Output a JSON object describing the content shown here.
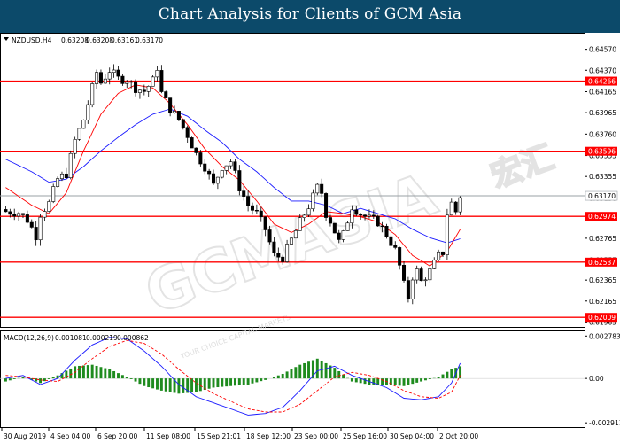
{
  "banner": {
    "title": "Chart Analysis for Clients of GCM Asia"
  },
  "watermark": {
    "brand": "GCMASIA",
    "chinese": "宏汇",
    "tagline": "YOUR CHOICE CAPITAL MARKETS"
  },
  "colors": {
    "banner": "#0c4a6a",
    "candle_up_fill": "#ffffff",
    "candle_outline": "#000000",
    "ma_fast": "#ff0000",
    "ma_slow": "#1a1aff",
    "level": "#ff0000",
    "level_label_bg": "#ff0000",
    "current_price": "#9aa0a6",
    "macd_hist": "#1e8b1e",
    "macd_line": "#1a1aff",
    "macd_signal": "#ff0000"
  },
  "chart_data": [
    {
      "type": "candlestick",
      "panel": "main",
      "header": {
        "symbol_timeframe": "NZDUSD,H4",
        "open": "0.63208",
        "high": "0.63208",
        "low": "0.63161",
        "close": "0.63170"
      },
      "y_axis_ticks": [
        "0.64570",
        "0.64370",
        "0.64165",
        "0.63965",
        "0.63760",
        "0.63555",
        "0.63355",
        "0.63150",
        "0.62950",
        "0.62765",
        "0.62555",
        "0.62365",
        "0.62165",
        "0.61965"
      ],
      "ylim": [
        0.6196,
        0.6466
      ],
      "x_axis_ticks": [
        "30 Aug 2019",
        "4 Sep 04:00",
        "6 Sep 20:00",
        "11 Sep 08:00",
        "15 Sep 21:01",
        "18 Sep 12:00",
        "23 Sep 00:00",
        "25 Sep 16:00",
        "30 Sep 04:00",
        "2 Oct 20:00"
      ],
      "levels": [
        {
          "label": "0.64266",
          "value": 0.64266
        },
        {
          "label": "0.63596",
          "value": 0.63596
        },
        {
          "label": "0.62974",
          "value": 0.62974
        },
        {
          "label": "0.62537",
          "value": 0.62537
        },
        {
          "label": "0.62009",
          "value": 0.62009
        }
      ],
      "current_price": {
        "label": "0.63170",
        "value": 0.6317
      },
      "close_path": [
        [
          0,
          0.6302
        ],
        [
          3,
          0.6301
        ],
        [
          5,
          0.6294
        ],
        [
          7,
          0.6279
        ],
        [
          8,
          0.63
        ],
        [
          10,
          0.631
        ],
        [
          12,
          0.6333
        ],
        [
          14,
          0.6338
        ],
        [
          16,
          0.637
        ],
        [
          18,
          0.639
        ],
        [
          20,
          0.642
        ],
        [
          21,
          0.6435
        ],
        [
          22,
          0.6425
        ],
        [
          24,
          0.6437
        ],
        [
          26,
          0.6429
        ],
        [
          28,
          0.6428
        ],
        [
          30,
          0.642
        ],
        [
          32,
          0.6417
        ],
        [
          34,
          0.6427
        ],
        [
          35,
          0.644
        ],
        [
          36,
          0.6415
        ],
        [
          38,
          0.64
        ],
        [
          40,
          0.639
        ],
        [
          42,
          0.6375
        ],
        [
          44,
          0.6357
        ],
        [
          46,
          0.6345
        ],
        [
          48,
          0.6327
        ],
        [
          50,
          0.6345
        ],
        [
          52,
          0.635
        ],
        [
          54,
          0.6325
        ],
        [
          56,
          0.6308
        ],
        [
          58,
          0.63
        ],
        [
          60,
          0.6285
        ],
        [
          62,
          0.626
        ],
        [
          64,
          0.6258
        ],
        [
          66,
          0.6275
        ],
        [
          68,
          0.6292
        ],
        [
          70,
          0.6307
        ],
        [
          72,
          0.6325
        ],
        [
          73,
          0.632
        ],
        [
          74,
          0.63
        ],
        [
          75,
          0.6293
        ],
        [
          77,
          0.6273
        ],
        [
          78,
          0.628
        ],
        [
          80,
          0.6307
        ],
        [
          82,
          0.63
        ],
        [
          84,
          0.6295
        ],
        [
          86,
          0.6292
        ],
        [
          88,
          0.628
        ],
        [
          90,
          0.6265
        ],
        [
          91,
          0.625
        ],
        [
          92,
          0.6232
        ],
        [
          93,
          0.622
        ],
        [
          94,
          0.624
        ],
        [
          95,
          0.6245
        ],
        [
          96,
          0.6235
        ],
        [
          98,
          0.6245
        ],
        [
          100,
          0.626
        ],
        [
          101,
          0.6263
        ],
        [
          102,
          0.63
        ],
        [
          103,
          0.631
        ],
        [
          104,
          0.6302
        ],
        [
          105,
          0.6317
        ]
      ],
      "ma_fast_path": [
        [
          0,
          0.6325
        ],
        [
          6,
          0.6308
        ],
        [
          10,
          0.63
        ],
        [
          14,
          0.632
        ],
        [
          18,
          0.636
        ],
        [
          22,
          0.6395
        ],
        [
          26,
          0.6415
        ],
        [
          30,
          0.6423
        ],
        [
          34,
          0.642
        ],
        [
          38,
          0.6405
        ],
        [
          42,
          0.6385
        ],
        [
          46,
          0.6362
        ],
        [
          50,
          0.6345
        ],
        [
          54,
          0.6332
        ],
        [
          58,
          0.6312
        ],
        [
          62,
          0.629
        ],
        [
          66,
          0.6282
        ],
        [
          70,
          0.629
        ],
        [
          74,
          0.6302
        ],
        [
          78,
          0.63
        ],
        [
          82,
          0.6297
        ],
        [
          86,
          0.6292
        ],
        [
          90,
          0.628
        ],
        [
          94,
          0.626
        ],
        [
          98,
          0.625
        ],
        [
          102,
          0.6264
        ],
        [
          105,
          0.6285
        ]
      ],
      "ma_slow_path": [
        [
          0,
          0.6352
        ],
        [
          6,
          0.634
        ],
        [
          10,
          0.633
        ],
        [
          14,
          0.6333
        ],
        [
          18,
          0.6345
        ],
        [
          22,
          0.636
        ],
        [
          26,
          0.6373
        ],
        [
          30,
          0.6385
        ],
        [
          34,
          0.6395
        ],
        [
          38,
          0.64
        ],
        [
          42,
          0.6393
        ],
        [
          46,
          0.638
        ],
        [
          50,
          0.6368
        ],
        [
          54,
          0.6352
        ],
        [
          58,
          0.634
        ],
        [
          62,
          0.6325
        ],
        [
          66,
          0.6312
        ],
        [
          70,
          0.6312
        ],
        [
          74,
          0.6308
        ],
        [
          78,
          0.63
        ],
        [
          82,
          0.6305
        ],
        [
          86,
          0.63
        ],
        [
          90,
          0.6295
        ],
        [
          94,
          0.6285
        ],
        [
          98,
          0.6277
        ],
        [
          102,
          0.6272
        ],
        [
          105,
          0.6276
        ]
      ]
    },
    {
      "type": "macd",
      "panel": "indicator",
      "header": {
        "label": "MACD(12,26,9)",
        "main": "0.001081",
        "signal": "0.000219",
        "histogram": "0.000862"
      },
      "y_axis_ticks": [
        "0.002783",
        "0.00",
        "-0.002911"
      ],
      "ylim": [
        -0.0029,
        0.0028
      ],
      "macd_path": [
        [
          0,
          0.0
        ],
        [
          4,
          0.0002
        ],
        [
          8,
          -0.0004
        ],
        [
          12,
          0.0
        ],
        [
          16,
          0.0012
        ],
        [
          20,
          0.0022
        ],
        [
          24,
          0.0027
        ],
        [
          28,
          0.0026
        ],
        [
          32,
          0.0018
        ],
        [
          36,
          0.0008
        ],
        [
          40,
          -0.0004
        ],
        [
          44,
          -0.0012
        ],
        [
          48,
          -0.0016
        ],
        [
          52,
          -0.002
        ],
        [
          56,
          -0.0024
        ],
        [
          60,
          -0.0023
        ],
        [
          64,
          -0.0019
        ],
        [
          68,
          -0.0008
        ],
        [
          72,
          0.0005
        ],
        [
          76,
          0.0008
        ],
        [
          80,
          0.0002
        ],
        [
          84,
          -0.0002
        ],
        [
          88,
          -0.0006
        ],
        [
          92,
          -0.0013
        ],
        [
          96,
          -0.0014
        ],
        [
          100,
          -0.0012
        ],
        [
          103,
          -0.0003
        ],
        [
          105,
          0.001
        ]
      ],
      "signal_path": [
        [
          0,
          0.0002
        ],
        [
          4,
          0.0001
        ],
        [
          8,
          -0.0001
        ],
        [
          12,
          -0.0002
        ],
        [
          16,
          0.0004
        ],
        [
          20,
          0.0013
        ],
        [
          24,
          0.0021
        ],
        [
          28,
          0.0025
        ],
        [
          32,
          0.0023
        ],
        [
          36,
          0.0016
        ],
        [
          40,
          0.0006
        ],
        [
          44,
          -0.0003
        ],
        [
          48,
          -0.001
        ],
        [
          52,
          -0.0015
        ],
        [
          56,
          -0.002
        ],
        [
          60,
          -0.0022
        ],
        [
          64,
          -0.0022
        ],
        [
          68,
          -0.0017
        ],
        [
          72,
          -0.0008
        ],
        [
          76,
          0.0001
        ],
        [
          80,
          0.0004
        ],
        [
          84,
          0.0002
        ],
        [
          88,
          -0.0002
        ],
        [
          92,
          -0.0008
        ],
        [
          96,
          -0.0012
        ],
        [
          100,
          -0.0013
        ],
        [
          103,
          -0.0009
        ],
        [
          105,
          0.0002
        ]
      ]
    }
  ]
}
